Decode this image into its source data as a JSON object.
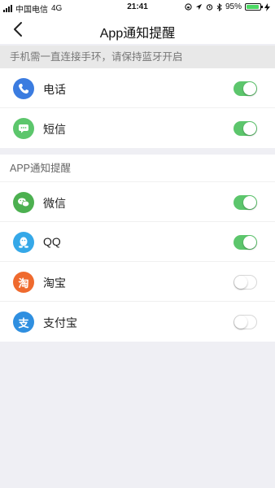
{
  "status_bar": {
    "carrier": "中国电信",
    "network": "4G",
    "time": "21:41",
    "battery_percent": "95%",
    "battery_level": 0.95
  },
  "nav": {
    "title": "App通知提醒",
    "back_icon": "chevron-left-icon"
  },
  "notice": "手机需一直连接手环，请保持蓝牙开启",
  "phone_items": [
    {
      "label": "电话",
      "icon": "phone-icon",
      "icon_color": "#3b7ce0",
      "enabled": true
    },
    {
      "label": "短信",
      "icon": "message-icon",
      "icon_color": "#5cc66c",
      "enabled": true
    }
  ],
  "app_section": {
    "header": "APP通知提醒",
    "items": [
      {
        "label": "微信",
        "icon": "wechat-icon",
        "icon_color": "#4cb050",
        "enabled": true
      },
      {
        "label": "QQ",
        "icon": "qq-icon",
        "icon_color": "#35a8e8",
        "enabled": true
      },
      {
        "label": "淘宝",
        "icon": "taobao-icon",
        "icon_color": "#ef6a2e",
        "icon_glyph": "淘",
        "enabled": false
      },
      {
        "label": "支付宝",
        "icon": "alipay-icon",
        "icon_color": "#2f8fe0",
        "icon_glyph": "支",
        "enabled": false
      }
    ]
  },
  "colors": {
    "toggle_on": "#5cc66c",
    "background": "#efeff4"
  }
}
